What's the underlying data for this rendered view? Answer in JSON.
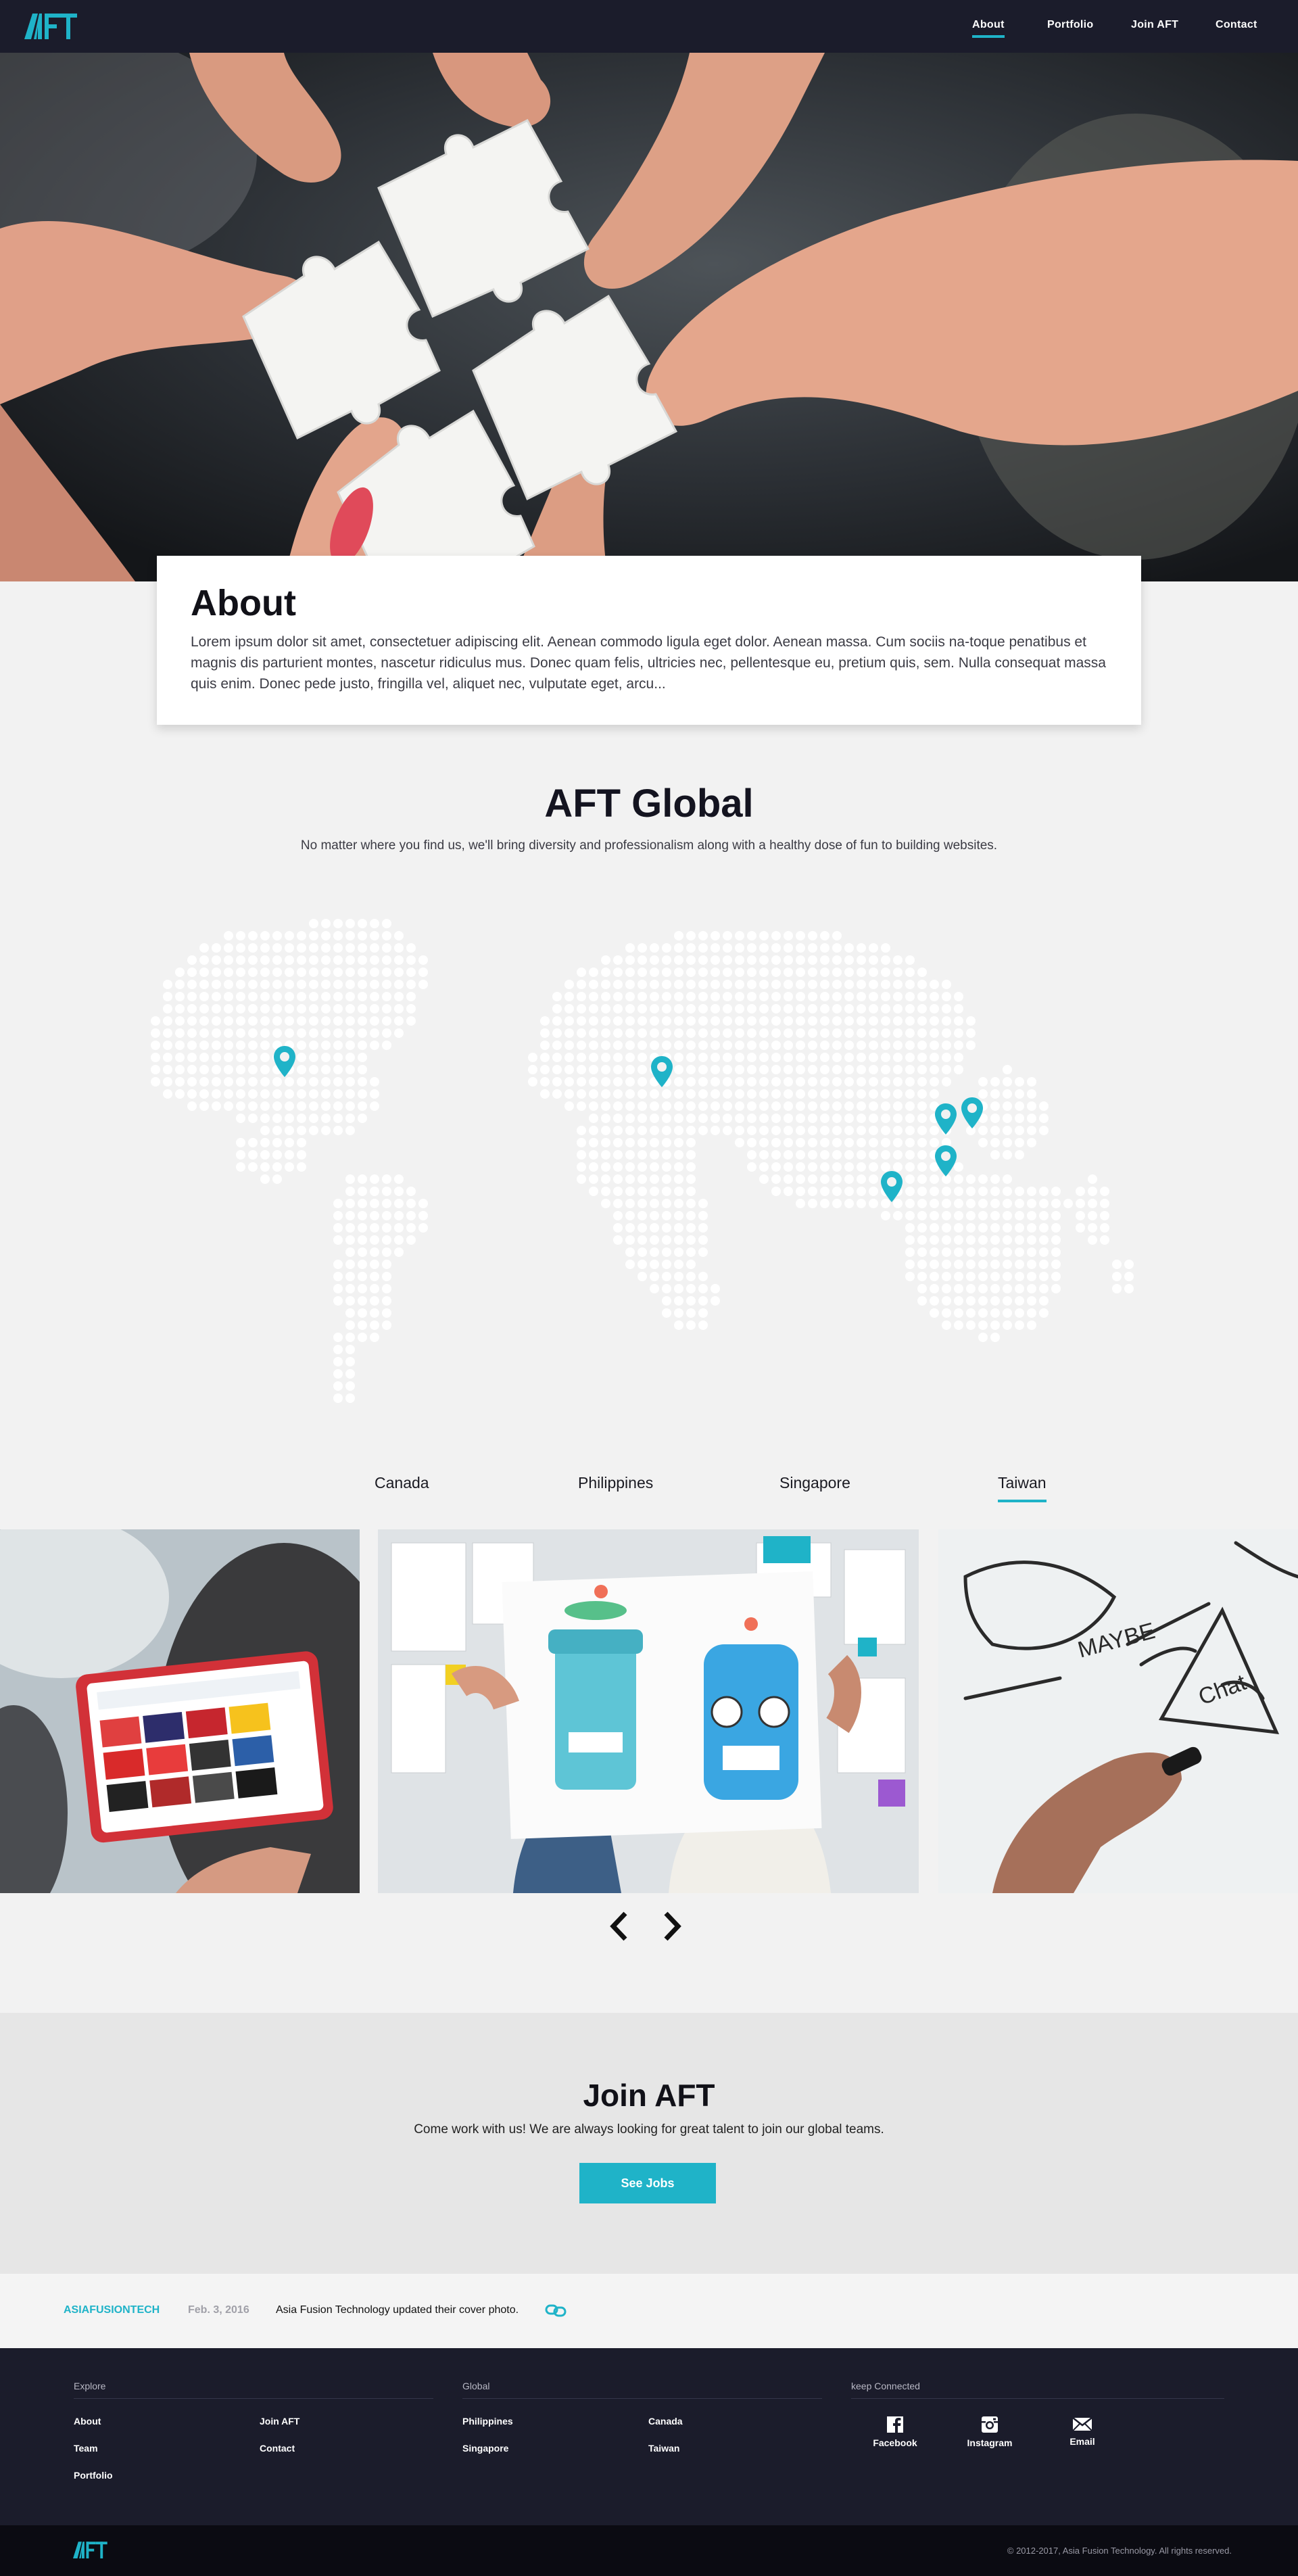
{
  "brand": {
    "logo_text": "AFT",
    "accent": "#1fb3c8",
    "dark": "#1b1c2b"
  },
  "nav": {
    "items": [
      {
        "label": "About",
        "active": true
      },
      {
        "label": "Portfolio",
        "active": false
      },
      {
        "label": "Join AFT",
        "active": false
      },
      {
        "label": "Contact",
        "active": false
      }
    ]
  },
  "about": {
    "title": "About",
    "body": "Lorem ipsum dolor sit amet, consectetuer adipiscing elit. Aenean commodo ligula eget dolor. Aenean massa. Cum sociis na-toque penatibus et magnis dis parturient montes, nascetur ridiculus mus. Donec quam felis, ultricies nec, pellentesque eu, pretium quis, sem. Nulla consequat massa quis enim. Donec pede justo, fringilla vel, aliquet nec, vulputate eget, arcu..."
  },
  "global": {
    "title": "AFT Global",
    "subtitle": "No matter where you find us, we'll bring diversity and professionalism along with a healthy dose of fun to building websites.",
    "pins": 6,
    "tabs": [
      {
        "label": "Canada",
        "active": false
      },
      {
        "label": "Philippines",
        "active": false
      },
      {
        "label": "Singapore",
        "active": false
      },
      {
        "label": "Taiwan",
        "active": true
      }
    ]
  },
  "join": {
    "title": "Join AFT",
    "subtitle": "Come work with us! We are always looking for great talent to join our global teams.",
    "button": "See Jobs"
  },
  "feed": {
    "handle": "ASIAFUSIONTECH",
    "date": "Feb. 3, 2016",
    "text": "Asia Fusion Technology updated their cover photo."
  },
  "footer": {
    "explore_heading": "Explore",
    "explore_links": [
      "About",
      "Join AFT",
      "Team",
      "Contact",
      "Portfolio"
    ],
    "global_heading": "Global",
    "global_links": [
      "Philippines",
      "Canada",
      "Singapore",
      "Taiwan"
    ],
    "connect_heading": "keep Connected",
    "social": [
      {
        "label": "Facebook",
        "icon": "facebook-icon"
      },
      {
        "label": "Instagram",
        "icon": "instagram-icon"
      },
      {
        "label": "Email",
        "icon": "email-icon"
      }
    ],
    "copyright": "© 2012-2017, Asia Fusion Technology. All rights reserved."
  }
}
